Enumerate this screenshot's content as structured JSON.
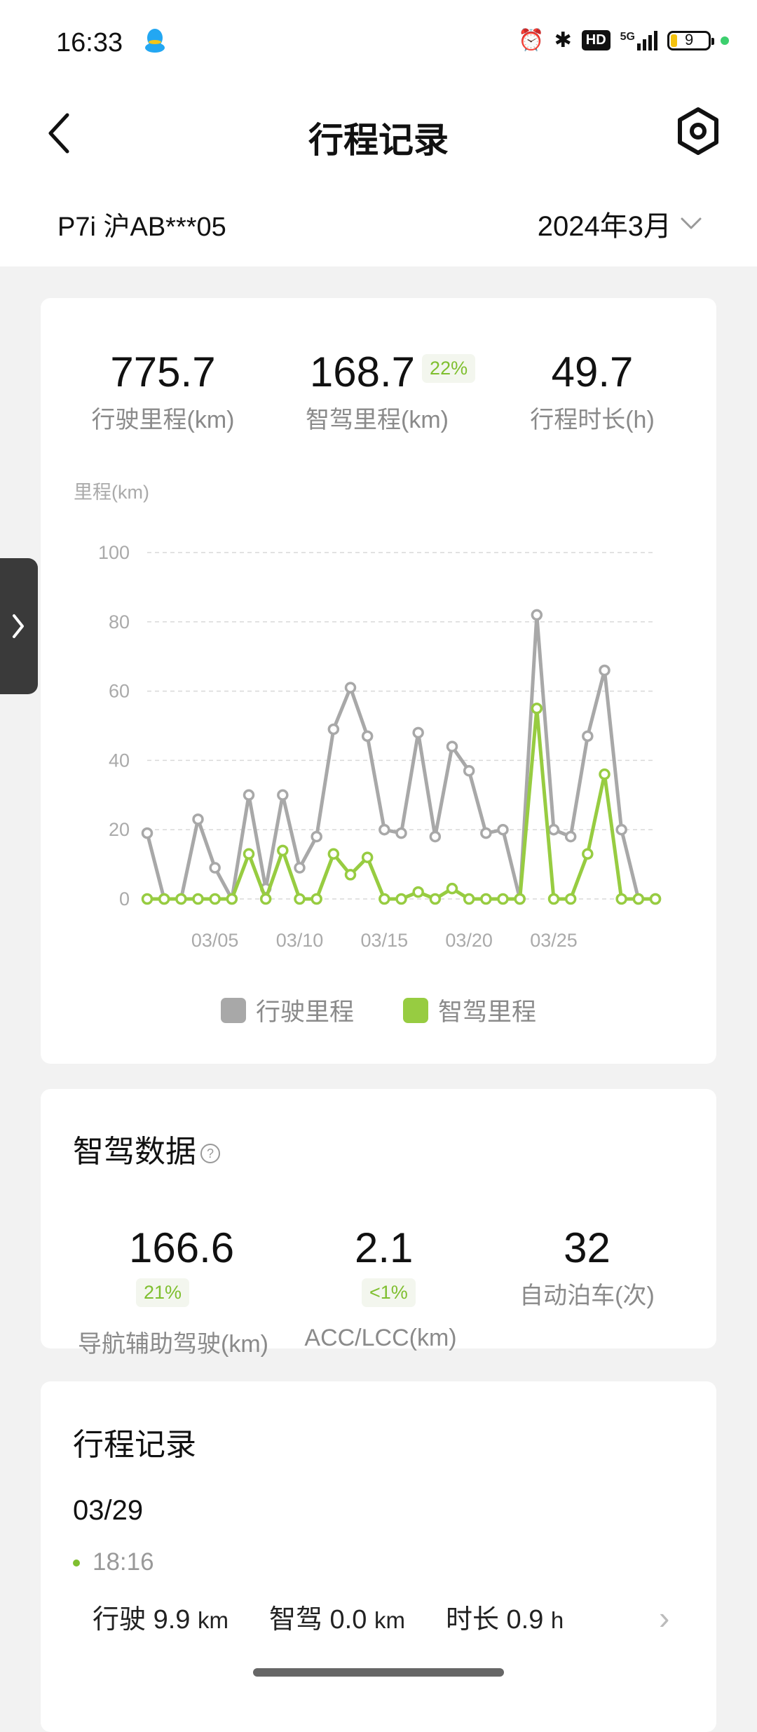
{
  "status_bar": {
    "time": "16:33",
    "icons": [
      "qq-icon",
      "alarm-icon",
      "bluetooth-icon",
      "hd-icon",
      "5g-signal-icon",
      "battery-icon"
    ],
    "hd": "HD",
    "signal": "5G",
    "battery_level": "9",
    "battery_fraction": 0.09
  },
  "header": {
    "title": "行程记录"
  },
  "vehicle": {
    "label": "P7i 沪AB***05",
    "month": "2024年3月"
  },
  "summary": {
    "total": {
      "value": "775.7",
      "label": "行驶里程(km)"
    },
    "smart": {
      "value": "168.7",
      "pct": "22%",
      "label": "智驾里程(km)"
    },
    "duration": {
      "value": "49.7",
      "label": "行程时长(h)"
    }
  },
  "chart_data": {
    "type": "line",
    "ylabel": "里程(km)",
    "ylim": [
      0,
      100
    ],
    "yticks": [
      "100",
      "80",
      "60",
      "40",
      "20",
      "0"
    ],
    "x": [
      "03/01",
      "03/02",
      "03/03",
      "03/04",
      "03/05",
      "03/06",
      "03/07",
      "03/08",
      "03/09",
      "03/10",
      "03/11",
      "03/12",
      "03/13",
      "03/14",
      "03/15",
      "03/16",
      "03/17",
      "03/18",
      "03/19",
      "03/20",
      "03/21",
      "03/22",
      "03/23",
      "03/24",
      "03/25",
      "03/26",
      "03/27",
      "03/28",
      "03/29",
      "03/30",
      "03/31"
    ],
    "xticks": [
      "03/05",
      "03/10",
      "03/15",
      "03/20",
      "03/25"
    ],
    "series": [
      {
        "name": "行驶里程",
        "color": "#a8a8a8",
        "values": [
          19,
          0,
          0,
          23,
          9,
          0,
          30,
          3,
          30,
          9,
          18,
          49,
          61,
          47,
          20,
          19,
          48,
          18,
          44,
          37,
          19,
          20,
          0,
          82,
          20,
          18,
          47,
          66,
          20,
          0,
          0
        ]
      },
      {
        "name": "智驾里程",
        "color": "#97cc41",
        "values": [
          0,
          0,
          0,
          0,
          0,
          0,
          13,
          0,
          14,
          0,
          0,
          13,
          7,
          12,
          0,
          0,
          2,
          0,
          3,
          0,
          0,
          0,
          0,
          55,
          0,
          0,
          13,
          36,
          0,
          0,
          0
        ]
      }
    ],
    "legend_position": "bottom-center",
    "grid": true
  },
  "smart_data": {
    "title": "智驾数据",
    "nav_assist": {
      "value": "166.6",
      "pct": "21%",
      "label": "导航辅助驾驶(km)"
    },
    "acc_lcc": {
      "value": "2.1",
      "pct": "<1%",
      "label": "ACC/LCC(km)"
    },
    "auto_park": {
      "value": "32",
      "label": "自动泊车(次)"
    }
  },
  "trips": {
    "title": "行程记录",
    "date": "03/29",
    "items": [
      {
        "time": "18:16",
        "drive_label": "行驶",
        "drive_value": "9.9",
        "drive_unit": "km",
        "smart_label": "智驾",
        "smart_value": "0.0",
        "smart_unit": "km",
        "duration_label": "时长",
        "duration_value": "0.9",
        "duration_unit": "h"
      }
    ]
  },
  "colors": {
    "accent_green": "#97cc41",
    "gray_series": "#a8a8a8",
    "badge_text": "#7fbf2f"
  }
}
